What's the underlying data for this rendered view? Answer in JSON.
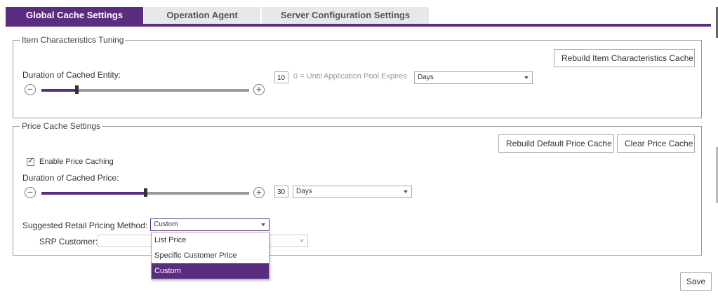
{
  "tabs": [
    {
      "label": "Global Cache Settings",
      "active": true
    },
    {
      "label": "Operation Agent",
      "active": false
    },
    {
      "label": "Server Configuration Settings",
      "active": false
    }
  ],
  "item_tuning": {
    "legend": "Item Characteristics Tuning",
    "rebuild_button": "Rebuild Item Characteristics Cache",
    "duration_label": "Duration of Cached Entity:",
    "duration_value": "10",
    "slider_fraction": 0.17,
    "hint": "0 = Until Application Pool Expires",
    "unit_selected": "Days"
  },
  "price_cache": {
    "legend": "Price Cache Settings",
    "rebuild_default_button": "Rebuild Default Price Cache",
    "clear_button": "Clear Price Cache",
    "enable_label": "Enable Price Caching",
    "enable_checked": true,
    "duration_label": "Duration of Cached Price:",
    "duration_value": "30",
    "slider_fraction": 0.5,
    "unit_selected": "Days",
    "srp_method_label": "Suggested Retail Pricing Method:",
    "srp_method_selected": "Custom",
    "srp_customer_label": "SRP Customer:",
    "srp_options": [
      "List Price",
      "Specific Customer Price",
      "Custom"
    ],
    "srp_options_selected_index": 2
  },
  "save_button": "Save",
  "colors": {
    "accent": "#5b2d80"
  }
}
